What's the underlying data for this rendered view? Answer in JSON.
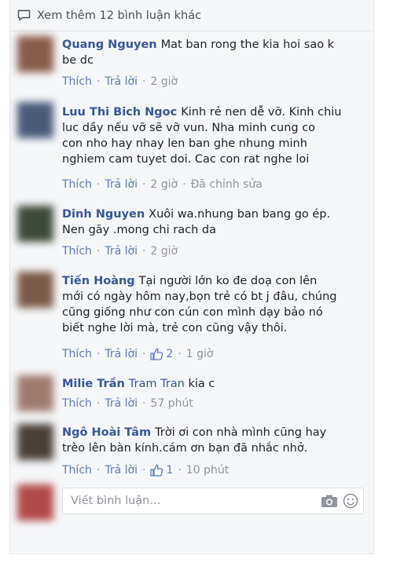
{
  "header": {
    "view_more_label": "Xem thêm 12 bình luận khác"
  },
  "actions": {
    "like": "Thích",
    "reply": "Trả lời",
    "separator": "·"
  },
  "comments": [
    {
      "author": "Quang Nguyen",
      "lines": [
        "Mat ban rong the kia hoi sao k",
        "be dc"
      ],
      "time": "2 giờ",
      "avatar_color": "#8a5a4a"
    },
    {
      "author": "Luu Thi Bich Ngoc",
      "lines": [
        "Kinh rẻ nen dễ vỡ. Kinh chiu",
        "luc dầy nếu vỡ sẽ vỡ vun. Nha minh cung co",
        "con nho hay nhay len ban ghe nhung minh",
        "nghiem cam tuyet doi. Cac con rat nghe loi"
      ],
      "time": "2 giờ",
      "edited": "Đã chỉnh sửa",
      "avatar_color": "#4a5a78"
    },
    {
      "author": "Dinh Nguyen",
      "lines": [
        "Xuôi wa.nhung ban bang go ép.",
        "Nen gãy .mong chi rach da"
      ],
      "time": "2 giờ",
      "avatar_color": "#3d4a3a"
    },
    {
      "author": "Tiến Hoàng",
      "lines": [
        "Tại người lớn ko đe doạ con lên",
        "mới có ngày hôm nay,bọn trẻ có bt j đâu, chúng",
        "cũng giống như con cún con mình dạy bảo nó",
        "biết nghe lời mà, trẻ con cũng vậy thôi."
      ],
      "likes": "2",
      "time": "1 giờ",
      "avatar_color": "#7a5a48"
    },
    {
      "author": "Milie Trần",
      "mention": "Tram Tran",
      "text": "kia c",
      "time": "57 phút",
      "avatar_color": "#a07a70"
    },
    {
      "author": "Ngô Hoài Tâm",
      "lines": [
        "Trời ơi con nhà mình cũng hay",
        "trèo lên bàn kính.cám ơn bạn đã nhắc nhở."
      ],
      "likes": "1",
      "time": "10 phút",
      "avatar_color": "#4a4038"
    }
  ],
  "composer": {
    "placeholder": "Viết bình luận...",
    "avatar_color": "#b04a48"
  },
  "colors": {
    "link": "#365899",
    "meta": "#90949c",
    "background": "#f6f7f9"
  }
}
